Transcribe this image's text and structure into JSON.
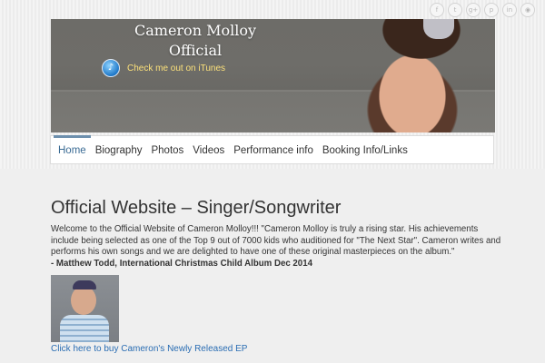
{
  "social": {
    "icons": [
      {
        "name": "facebook-icon",
        "glyph": "f"
      },
      {
        "name": "twitter-icon",
        "glyph": "t"
      },
      {
        "name": "google-plus-icon",
        "glyph": "g+"
      },
      {
        "name": "pinterest-icon",
        "glyph": "p"
      },
      {
        "name": "linkedin-icon",
        "glyph": "in"
      },
      {
        "name": "rss-icon",
        "glyph": "◉"
      }
    ]
  },
  "banner": {
    "brand_line1": "Cameron Molloy",
    "brand_line2": "Official",
    "itunes_link": "Check me out on iTunes",
    "itunes_icon": "itunes-icon"
  },
  "nav": {
    "items": [
      "Home",
      "Biography",
      "Photos",
      "Videos",
      "Performance info",
      "Booking Info/Links"
    ],
    "active": "Home",
    "accent_color": "#3a6b94"
  },
  "content": {
    "title": "Official Website – Singer/Songwriter",
    "body": "Welcome to the Official Website of Cameron Molloy!!! \"Cameron Molloy is truly a rising star. His achievements include being selected as one of the Top 9 out of 7000 kids who auditioned for \"The Next Star\". Cameron writes and performs his own songs and we are delighted to have one of these original masterpieces on the album.\"",
    "attribution": "- Matthew Todd, International Christmas Child Album Dec 2014",
    "buy_link": "Click here to buy Cameron's Newly Released EP"
  }
}
